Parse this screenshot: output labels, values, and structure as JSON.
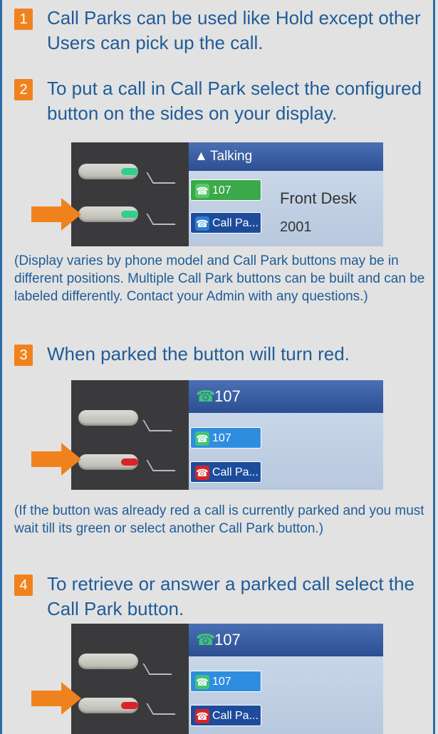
{
  "steps": [
    {
      "number": "1",
      "text": "Call Parks can be used like Hold except other Users can pick up the call."
    },
    {
      "number": "2",
      "text": "To put a call in Call Park select the configured button on the sides on your display."
    },
    {
      "number": "3",
      "text": "When parked the button will turn red."
    },
    {
      "number": "4",
      "text": "To retrieve or answer a parked call select the Call Park button."
    }
  ],
  "notes": {
    "display_varies": "(Display varies by phone model and Call Park buttons may be in different positions. Multiple Call Park buttons can be built and can be labeled differently. Contact your Admin with any questions.)",
    "already_red": "(If the button was already red a call is currently parked and you must wait till its green or select another Call Park button.)"
  },
  "photo1": {
    "header": "Talking",
    "key1_label": "107",
    "key2_label": "Call Pa...",
    "caller_name": "Front Desk",
    "caller_number": "2001",
    "led_color": "#2fd08a"
  },
  "photo2": {
    "header": "107",
    "key1_label": "107",
    "key2_label": "Call Pa...",
    "parked_led_color": "#d8232a"
  },
  "photo3": {
    "header": "107",
    "key1_label": "107",
    "key2_label": "Call Pa...",
    "parked_led_color": "#d8232a"
  },
  "colors": {
    "badge": "#f0821e",
    "text": "#1f5c98",
    "border": "#2b6ca8",
    "arrow": "#f0821e"
  }
}
